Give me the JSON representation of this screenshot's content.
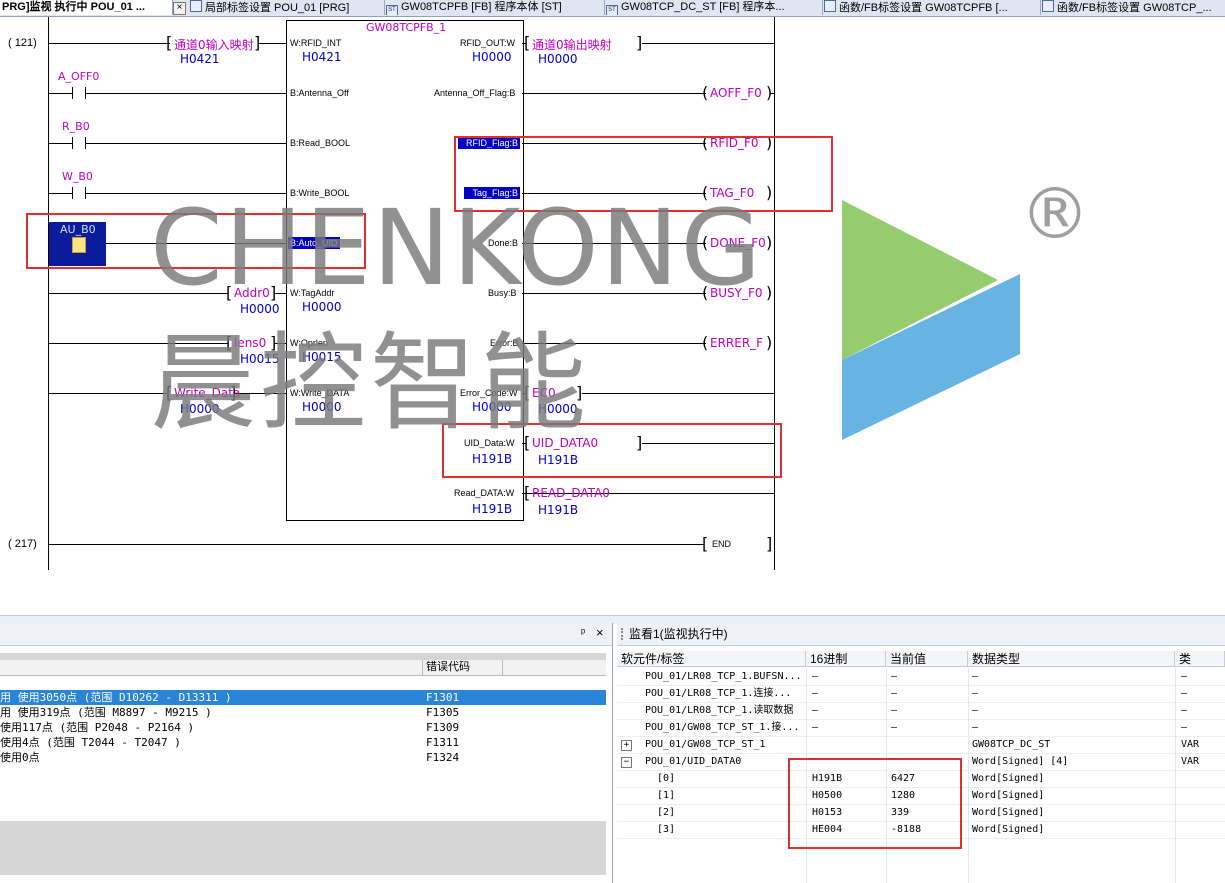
{
  "tabs": [
    {
      "label": "PRG]监视 执行中 POU_01 ..."
    },
    {
      "label": "局部标签设置 POU_01 [PRG]"
    },
    {
      "label": "GW08TCPFB [FB] 程序本体 [ST]"
    },
    {
      "label": "GW08TCP_DC_ST [FB] 程序本..."
    },
    {
      "label": "函数/FB标签设置 GW08TCPFB [..."
    },
    {
      "label": "函数/FB标签设置 GW08TCP_..."
    }
  ],
  "ladder": {
    "step_start": "( 121)",
    "step_end": "( 217)",
    "fb_name": "GW08TCPFB_1",
    "inputs": [
      {
        "pin": "W:RFID_INT",
        "value": "H0421",
        "label": "通道0输入映射",
        "label_value": "H0421"
      },
      {
        "pin": "B:Antenna_Off",
        "contact": "A_OFF0"
      },
      {
        "pin": "B:Read_BOOL",
        "contact": "R_B0"
      },
      {
        "pin": "B:Write_BOOL",
        "contact": "W_B0"
      },
      {
        "pin": "B:Auto_UID",
        "contact": "AU_B0"
      },
      {
        "pin": "W:TagAddr",
        "value": "H0000",
        "label": "Addr0",
        "label_value": "H0000"
      },
      {
        "pin": "W:Oprlen",
        "value": "H0015",
        "label": "lens0",
        "label_value": "H0015"
      },
      {
        "pin": "W:Write_DATA",
        "value": "H0000",
        "label": "Write_Data",
        "label_value": "H0000"
      }
    ],
    "outputs": [
      {
        "pin": "RFID_OUT:W",
        "value": "H0000",
        "label": "通道0输出映射",
        "label_value": "H0000"
      },
      {
        "pin": "Antenna_Off_Flag:B",
        "coil": "AOFF_F0"
      },
      {
        "pin": "RFID_Flag:B",
        "coil": "RFID_F0"
      },
      {
        "pin": "Tag_Flag:B",
        "coil": "TAG_F0"
      },
      {
        "pin": "Done:B",
        "coil": "DONE_F0"
      },
      {
        "pin": "Busy:B",
        "coil": "BUSY_F0"
      },
      {
        "pin": "Error:B",
        "coil": "ERRER_F"
      },
      {
        "pin": "Error_Code:W",
        "value": "H0000",
        "label": "EC0",
        "label_value": "H0000"
      },
      {
        "pin": "UID_Data:W",
        "value": "H191B",
        "label": "UID_DATA0",
        "label_value": "H191B"
      },
      {
        "pin": "Read_DATA:W",
        "value": "H191B",
        "label": "READ_DATA0",
        "label_value": "H191B"
      }
    ],
    "end_label": "END"
  },
  "watermark": {
    "en": "CHENKONG",
    "cn": "晨控智能",
    "reg": "®",
    "colors": [
      "#8bc862",
      "#5aade0"
    ]
  },
  "left_pane": {
    "pin_icon": "ᵖ",
    "close_icon": "×",
    "col_error": "错误代码",
    "rows": [
      {
        "text": "用 使用3050点 (范围 D10262 - D13311 )",
        "code": "F1301"
      },
      {
        "text": "用 使用319点 (范围 M8897 - M9215 )",
        "code": "F1305"
      },
      {
        "text": "使用117点 (范围 P2048 - P2164 )",
        "code": "F1309"
      },
      {
        "text": " 使用4点 (范围 T2044 - T2047 )",
        "code": "F1311"
      },
      {
        "text": " 使用0点",
        "code": "F1324"
      }
    ]
  },
  "watch": {
    "title": "监看1(监视执行中)",
    "columns": [
      "软元件/标签",
      "16进制",
      "当前值",
      "数据类型",
      "类"
    ],
    "rows": [
      {
        "name": "POU_01/LR08_TCP_1.BUFSN...",
        "hex": "—",
        "val": "—",
        "type": "—",
        "cls": "—"
      },
      {
        "name": "POU_01/LR08_TCP_1.连接...",
        "hex": "—",
        "val": "—",
        "type": "—",
        "cls": "—"
      },
      {
        "name": "POU_01/LR08_TCP_1.读取数据",
        "hex": "—",
        "val": "—",
        "type": "—",
        "cls": "—"
      },
      {
        "name": "POU_01/GW08_TCP_ST_1.接...",
        "hex": "—",
        "val": "—",
        "type": "—",
        "cls": "—"
      },
      {
        "name": "POU_01/GW08_TCP_ST_1",
        "hex": "",
        "val": "",
        "type": "GW08TCP_DC_ST",
        "cls": "VAR",
        "exp": "+"
      },
      {
        "name": "POU_01/UID_DATA0",
        "hex": "",
        "val": "",
        "type": "Word[Signed] [4]",
        "cls": "VAR",
        "exp": "−"
      },
      {
        "name": "[0]",
        "hex": "H191B",
        "val": "6427",
        "type": "Word[Signed]",
        "cls": ""
      },
      {
        "name": "[1]",
        "hex": "H0500",
        "val": "1280",
        "type": "Word[Signed]",
        "cls": ""
      },
      {
        "name": "[2]",
        "hex": "H0153",
        "val": "339",
        "type": "Word[Signed]",
        "cls": ""
      },
      {
        "name": "[3]",
        "hex": "HE004",
        "val": "-8188",
        "type": "Word[Signed]",
        "cls": ""
      }
    ]
  }
}
